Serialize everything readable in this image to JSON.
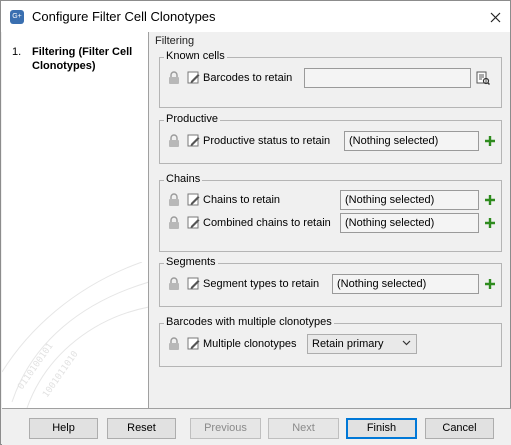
{
  "window": {
    "title": "Configure Filter Cell Clonotypes",
    "app_icon_text": "G+"
  },
  "steps": [
    {
      "number": "1.",
      "label": "Filtering (Filter Cell Clonotypes)"
    }
  ],
  "panel": {
    "title": "Filtering",
    "groups": {
      "known_cells": {
        "title": "Known cells",
        "barcodes_label": "Barcodes to retain",
        "barcodes_value": ""
      },
      "productive": {
        "title": "Productive",
        "status_label": "Productive status to retain",
        "status_value": "(Nothing selected)"
      },
      "chains": {
        "title": "Chains",
        "chains_label": "Chains to retain",
        "chains_value": "(Nothing selected)",
        "combined_label": "Combined chains to retain",
        "combined_value": "(Nothing selected)"
      },
      "segments": {
        "title": "Segments",
        "types_label": "Segment types to retain",
        "types_value": "(Nothing selected)"
      },
      "multiple": {
        "title": "Barcodes with multiple clonotypes",
        "label": "Multiple clonotypes",
        "selected": "Retain primary"
      }
    }
  },
  "buttons": {
    "help": "Help",
    "reset": "Reset",
    "previous": "Previous",
    "next": "Next",
    "finish": "Finish",
    "cancel": "Cancel"
  },
  "icons": {
    "lock": "lock-icon",
    "pencil": "pencil-icon",
    "plus": "plus-icon",
    "browse": "browse-file-icon",
    "close": "close-icon"
  },
  "colors": {
    "accent": "#0078d7",
    "plus_green": "#2e8b1e"
  }
}
